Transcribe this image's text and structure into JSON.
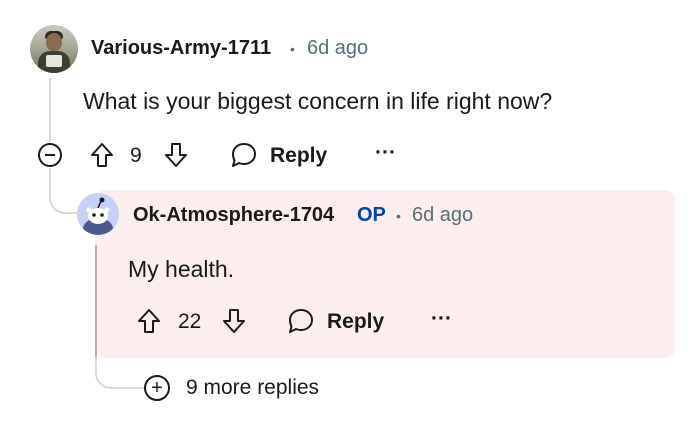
{
  "parent_comment": {
    "username": "Various-Army-1711",
    "time": "6d ago",
    "body": "What is your biggest concern in life right now?",
    "score": "9",
    "reply_label": "Reply",
    "more_label": "···"
  },
  "reply_comment": {
    "username": "Ok-Atmosphere-1704",
    "op_badge": "OP",
    "time": "6d ago",
    "body": "My health.",
    "score": "22",
    "reply_label": "Reply",
    "more_label": "···"
  },
  "more_replies": {
    "plus": "+",
    "label": "9 more replies"
  },
  "separator": "•",
  "colors": {
    "reply_background": "#fbeeec",
    "op_badge": "#0045ac",
    "meta_gray": "#576f76",
    "thread_line": "#d7dadc"
  }
}
